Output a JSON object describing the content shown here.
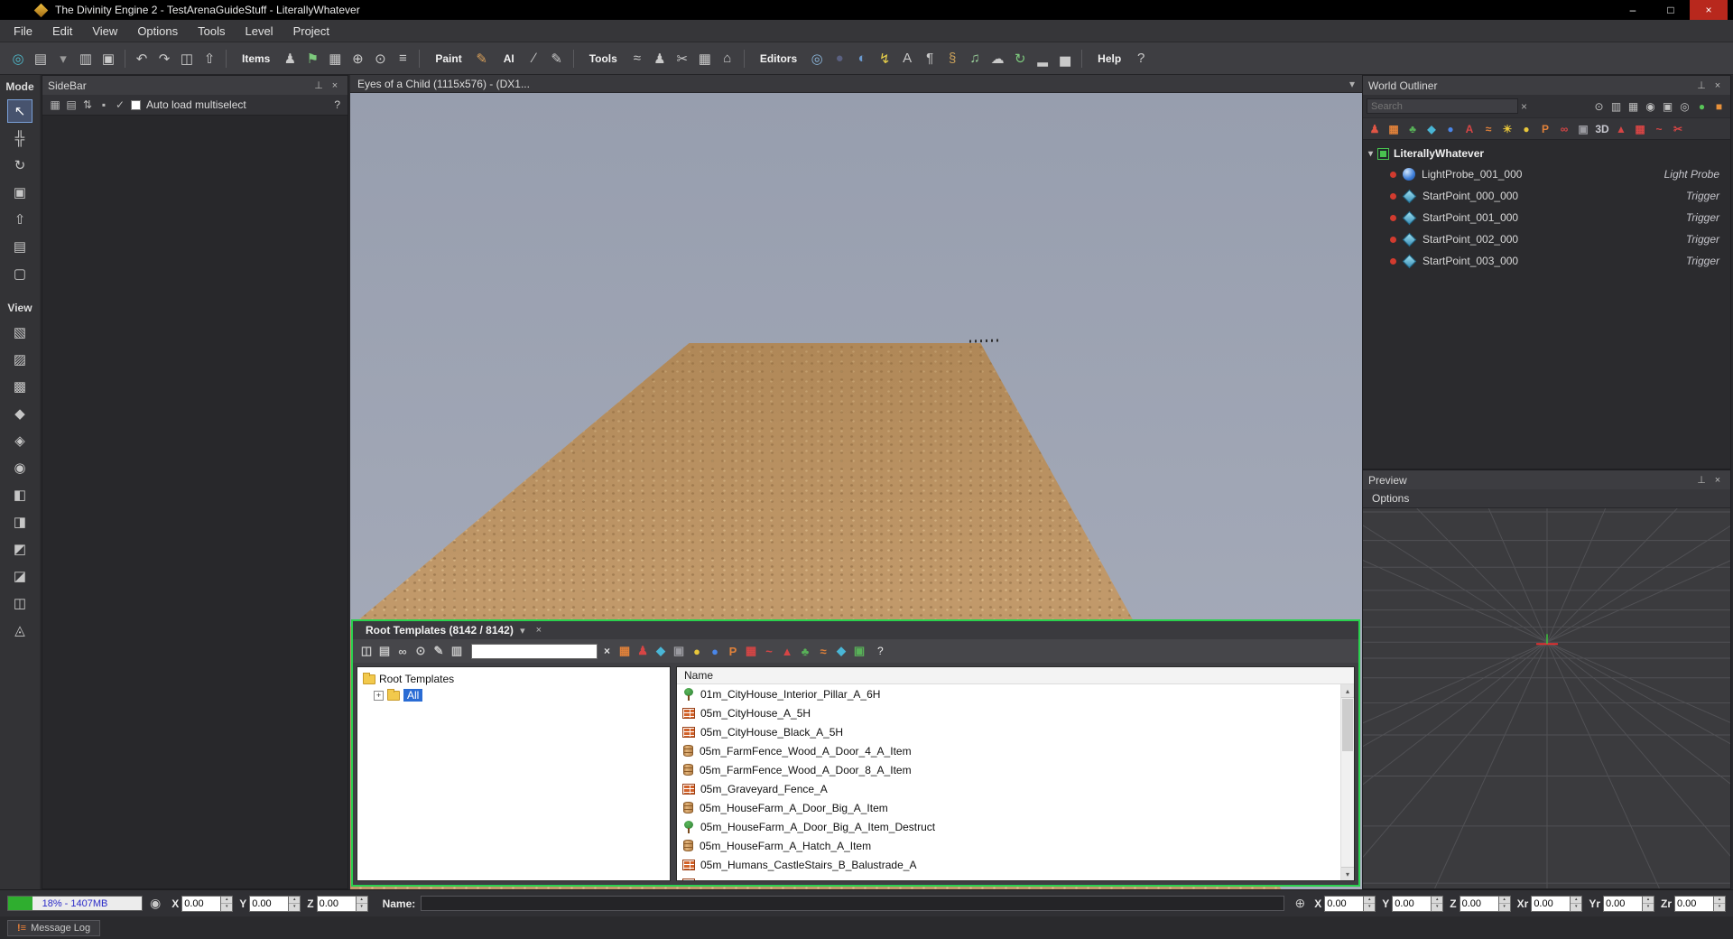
{
  "window": {
    "title": "The Divinity Engine 2 - TestArenaGuideStuff - LiterallyWhatever",
    "minimize_glyph": "–",
    "maximize_glyph": "□",
    "close_glyph": "×"
  },
  "glyphs": {
    "pin": "⊥",
    "close": "×",
    "caret_down": "▾",
    "root_caret": "▾",
    "expander_plus": "+",
    "crosshair": "⊕",
    "camera": "◉",
    "up_arrow": "▴",
    "down_arrow": "▾",
    "clear": "×"
  },
  "menu": {
    "items": [
      "File",
      "Edit",
      "View",
      "Options",
      "Tools",
      "Level",
      "Project"
    ]
  },
  "toolbar": {
    "groups": [
      {
        "type": "icons",
        "icons": [
          {
            "name": "engine-home-icon",
            "glyph": "◎",
            "color": "#4fb8c9"
          },
          {
            "name": "new-document-icon",
            "glyph": "▤",
            "color": "#c9c9c9"
          },
          {
            "name": "new-document-caret-icon",
            "glyph": "▾",
            "color": "#9a9a9a"
          },
          {
            "name": "open-project-icon",
            "glyph": "▥",
            "color": "#c9c9c9"
          },
          {
            "name": "save-all-icon",
            "glyph": "▣",
            "color": "#c9c9c9"
          }
        ]
      },
      {
        "type": "sep"
      },
      {
        "type": "icons",
        "icons": [
          {
            "name": "undo-icon",
            "glyph": "↶",
            "color": "#c9c9c9"
          },
          {
            "name": "redo-icon",
            "glyph": "↷",
            "color": "#c9c9c9"
          },
          {
            "name": "save-icon",
            "glyph": "◫",
            "color": "#c9c9c9"
          },
          {
            "name": "export-icon",
            "glyph": "⇧",
            "color": "#c9c9c9"
          }
        ]
      },
      {
        "type": "sep"
      },
      {
        "type": "label",
        "text": "Items"
      },
      {
        "type": "icons",
        "icons": [
          {
            "name": "character-tool-icon",
            "glyph": "♟",
            "color": "#c9c9c9"
          },
          {
            "name": "flag-tool-icon",
            "glyph": "⚑",
            "color": "#7dc97d"
          },
          {
            "name": "prefab-grid-icon",
            "glyph": "▦",
            "color": "#c9c9c9"
          },
          {
            "name": "snap-target-icon",
            "glyph": "⊕",
            "color": "#c9c9c9"
          },
          {
            "name": "magnify-icon",
            "glyph": "⊙",
            "color": "#c9c9c9"
          },
          {
            "name": "list-icon",
            "glyph": "≡",
            "color": "#c9c9c9"
          }
        ]
      },
      {
        "type": "sep"
      },
      {
        "type": "label",
        "text": "Paint"
      },
      {
        "type": "icons",
        "icons": [
          {
            "name": "paint-brush-icon",
            "glyph": "✎",
            "color": "#d9a05a"
          }
        ]
      },
      {
        "type": "label",
        "text": "AI"
      },
      {
        "type": "icons",
        "icons": [
          {
            "name": "ai-slope-icon",
            "glyph": "∕",
            "color": "#c9c9c9"
          },
          {
            "name": "ai-paint-icon",
            "glyph": "✎",
            "color": "#c9c9c9"
          }
        ]
      },
      {
        "type": "sep"
      },
      {
        "type": "label",
        "text": "Tools"
      },
      {
        "type": "icons",
        "icons": [
          {
            "name": "wave-tool-icon",
            "glyph": "≈",
            "color": "#c9c9c9"
          },
          {
            "name": "crowd-tool-icon",
            "glyph": "♟",
            "color": "#c9c9c9"
          },
          {
            "name": "cut-tool-icon",
            "glyph": "✂",
            "color": "#c9c9c9"
          },
          {
            "name": "grid-tool-icon",
            "glyph": "▦",
            "color": "#c9c9c9"
          },
          {
            "name": "home-tool-icon",
            "glyph": "⌂",
            "color": "#c9c9c9"
          }
        ]
      },
      {
        "type": "sep"
      },
      {
        "type": "label",
        "text": "Editors"
      },
      {
        "type": "icons",
        "icons": [
          {
            "name": "world-editor-icon",
            "glyph": "◎",
            "color": "#8ab4d8"
          },
          {
            "name": "sphere-editor-icon",
            "glyph": "●",
            "color": "#5a6080"
          },
          {
            "name": "planet-editor-icon",
            "glyph": "◐",
            "color": "#6a9ad0"
          },
          {
            "name": "lightning-editor-icon",
            "glyph": "↯",
            "color": "#e8d04a"
          },
          {
            "name": "text-editor-icon",
            "glyph": "A",
            "color": "#c9c9c9"
          },
          {
            "name": "dialog-editor-icon",
            "glyph": "¶",
            "color": "#c9c9c9"
          },
          {
            "name": "script-editor-icon",
            "glyph": "§",
            "color": "#c9a05a"
          },
          {
            "name": "music-editor-icon",
            "glyph": "♫",
            "color": "#9ad09a"
          },
          {
            "name": "cloud-editor-icon",
            "glyph": "☁",
            "color": "#c9c9c9"
          },
          {
            "name": "sync-editor-icon",
            "glyph": "↻",
            "color": "#7dc97d"
          },
          {
            "name": "stats-editor-icon",
            "glyph": "▂",
            "color": "#c9c9c9"
          },
          {
            "name": "chart-editor-icon",
            "glyph": "▅",
            "color": "#c9c9c9"
          }
        ]
      },
      {
        "type": "sep"
      },
      {
        "type": "label",
        "text": "Help"
      },
      {
        "type": "icons",
        "icons": [
          {
            "name": "help-icon",
            "glyph": "?",
            "color": "#c9c9c9"
          }
        ]
      }
    ]
  },
  "mode_panel": {
    "mode_label": "Mode",
    "view_label": "View",
    "mode_tools": [
      {
        "name": "select-tool",
        "glyph": "↖"
      },
      {
        "name": "move-tool",
        "glyph": "╬"
      },
      {
        "name": "rotate-tool",
        "glyph": "↻"
      },
      {
        "name": "terrain-tool",
        "glyph": "▣"
      },
      {
        "name": "raise-tool",
        "glyph": "⇧"
      },
      {
        "name": "texture-tool",
        "glyph": "▤"
      },
      {
        "name": "document-tool",
        "glyph": "▢"
      }
    ],
    "view_tools": [
      {
        "name": "view-cube-icon",
        "glyph": "▧"
      },
      {
        "name": "view-shaded-icon",
        "glyph": "▨"
      },
      {
        "name": "view-wireframe-icon",
        "glyph": "▩"
      },
      {
        "name": "view-normals-icon",
        "glyph": "◆"
      },
      {
        "name": "view-gizmo-icon",
        "glyph": "◈"
      },
      {
        "name": "view-camera-icon",
        "glyph": "◉"
      },
      {
        "name": "view-left-icon",
        "glyph": "◧"
      },
      {
        "name": "view-right-icon",
        "glyph": "◨"
      },
      {
        "name": "view-top-icon",
        "glyph": "◩"
      },
      {
        "name": "view-bottom-icon",
        "glyph": "◪"
      },
      {
        "name": "view-split-icon",
        "glyph": "◫"
      },
      {
        "name": "view-iso-icon",
        "glyph": "◬"
      }
    ]
  },
  "sidebar": {
    "title": "SideBar",
    "icons": [
      {
        "name": "sidebar-grid-icon",
        "glyph": "▦"
      },
      {
        "name": "sidebar-list-icon",
        "glyph": "▤"
      },
      {
        "name": "sidebar-sort-icon",
        "glyph": "⇅"
      },
      {
        "name": "sidebar-lock-icon",
        "glyph": "▪"
      },
      {
        "name": "sidebar-apply-icon",
        "glyph": "✓"
      }
    ],
    "auto_load_label": "Auto load multiselect",
    "help_label": "?"
  },
  "viewport": {
    "tab_title": "Eyes of a Child (1115x576) - (DX1..."
  },
  "world_outliner": {
    "title": "World Outliner",
    "search_placeholder": "Search",
    "header_icons": [
      {
        "name": "outliner-search-icon",
        "glyph": "⊙",
        "color": "#c0c0c0"
      },
      {
        "name": "outliner-copy-icon",
        "glyph": "▥",
        "color": "#c0c0c0"
      },
      {
        "name": "outliner-group-icon",
        "glyph": "▦",
        "color": "#c0c0c0"
      },
      {
        "name": "outliner-eye-icon",
        "glyph": "◉",
        "color": "#c0c0c0"
      },
      {
        "name": "outliner-lock-icon",
        "glyph": "▣",
        "color": "#c0c0c0"
      },
      {
        "name": "outliner-world-icon",
        "glyph": "◎",
        "color": "#c0c0c0"
      },
      {
        "name": "outliner-status-green-icon",
        "glyph": "●",
        "color": "#58c558"
      },
      {
        "name": "outliner-status-orange-icon",
        "glyph": "■",
        "color": "#e8913a"
      }
    ],
    "filters": [
      {
        "name": "filter-character-icon",
        "glyph": "♟",
        "color": "#e05545"
      },
      {
        "name": "filter-scenery-icon",
        "glyph": "▦",
        "color": "#e0813a"
      },
      {
        "name": "filter-vegetation-icon",
        "glyph": "♣",
        "color": "#58b158"
      },
      {
        "name": "filter-trigger-icon",
        "glyph": "◆",
        "color": "#49b6d6"
      },
      {
        "name": "filter-light-icon",
        "glyph": "●",
        "color": "#4a86e8"
      },
      {
        "name": "filter-decal-icon",
        "glyph": "A",
        "color": "#d64545"
      },
      {
        "name": "filter-effect-icon",
        "glyph": "≈",
        "color": "#e0813a"
      },
      {
        "name": "filter-lightprobe-icon",
        "glyph": "☀",
        "color": "#e8c63a"
      },
      {
        "name": "filter-bulb-icon",
        "glyph": "●",
        "color": "#e8c63a"
      },
      {
        "name": "filter-prefab-icon",
        "glyph": "P",
        "color": "#e0813a"
      },
      {
        "name": "filter-link-icon",
        "glyph": "∞",
        "color": "#d64545"
      },
      {
        "name": "filter-camera-icon",
        "glyph": "▣",
        "color": "#9a9aa0"
      },
      {
        "name": "filter-3d-icon",
        "glyph": "3D",
        "color": "#c8c8d0"
      },
      {
        "name": "filter-terrain-icon",
        "glyph": "▲",
        "color": "#d64545"
      },
      {
        "name": "filter-region-icon",
        "glyph": "▦",
        "color": "#d64545"
      },
      {
        "name": "filter-spline-icon",
        "glyph": "~",
        "color": "#d64545"
      },
      {
        "name": "filter-misc-icon",
        "glyph": "✂",
        "color": "#d64545"
      }
    ],
    "root_label": "LiterallyWhatever",
    "items": [
      {
        "icon": "light-probe",
        "name": "LightProbe_001_000",
        "type": "Light Probe"
      },
      {
        "icon": "trigger",
        "name": "StartPoint_000_000",
        "type": "Trigger"
      },
      {
        "icon": "trigger",
        "name": "StartPoint_001_000",
        "type": "Trigger"
      },
      {
        "icon": "trigger",
        "name": "StartPoint_002_000",
        "type": "Trigger"
      },
      {
        "icon": "trigger",
        "name": "StartPoint_003_000",
        "type": "Trigger"
      }
    ]
  },
  "preview": {
    "title": "Preview",
    "options_label": "Options"
  },
  "root_templates": {
    "title": "Root Templates (8142 / 8142)",
    "toolbar_icons": [
      {
        "name": "rt-save-icon",
        "glyph": "◫"
      },
      {
        "name": "rt-import-icon",
        "glyph": "▤"
      },
      {
        "name": "rt-link-icon",
        "glyph": "∞"
      },
      {
        "name": "rt-binocular-icon",
        "glyph": "⊙"
      },
      {
        "name": "rt-edit-icon",
        "glyph": "✎"
      },
      {
        "name": "rt-list-icon",
        "glyph": "▥"
      }
    ],
    "filter_icons": [
      {
        "name": "rt-filter-scenery-icon",
        "glyph": "▦",
        "color": "#e0813a"
      },
      {
        "name": "rt-filter-character-icon",
        "glyph": "♟",
        "color": "#d64545"
      },
      {
        "name": "rt-filter-trigger-icon",
        "glyph": "◆",
        "color": "#49b6d6"
      },
      {
        "name": "rt-filter-item-icon",
        "glyph": "▣",
        "color": "#9a9aa0"
      },
      {
        "name": "rt-filter-light-icon",
        "glyph": "●",
        "color": "#e8c63a"
      },
      {
        "name": "rt-filter-sphere-icon",
        "glyph": "●",
        "color": "#4a86e8"
      },
      {
        "name": "rt-filter-prefab-icon",
        "glyph": "P",
        "color": "#e0813a"
      },
      {
        "name": "rt-filter-grid-icon",
        "glyph": "▦",
        "color": "#d64545"
      },
      {
        "name": "rt-filter-spline-icon",
        "glyph": "~",
        "color": "#d64545"
      },
      {
        "name": "rt-filter-terrain-icon",
        "glyph": "▲",
        "color": "#d64545"
      },
      {
        "name": "rt-filter-vegetation-icon",
        "glyph": "♣",
        "color": "#58b158"
      },
      {
        "name": "rt-filter-effect-icon",
        "glyph": "≈",
        "color": "#e0813a"
      },
      {
        "name": "rt-filter-decal-icon",
        "glyph": "◆",
        "color": "#49b6d6"
      },
      {
        "name": "rt-filter-box-icon",
        "glyph": "▣",
        "color": "#58b158"
      }
    ],
    "help_label": "?",
    "tree": {
      "root": "Root Templates",
      "child": "All"
    },
    "list": {
      "header": "Name",
      "rows": [
        {
          "icon": "tree",
          "name": "01m_CityHouse_Interior_Pillar_A_6H"
        },
        {
          "icon": "brick",
          "name": "05m_CityHouse_A_5H"
        },
        {
          "icon": "brick",
          "name": "05m_CityHouse_Black_A_5H"
        },
        {
          "icon": "barrel",
          "name": "05m_FarmFence_Wood_A_Door_4_A_Item"
        },
        {
          "icon": "barrel",
          "name": "05m_FarmFence_Wood_A_Door_8_A_Item"
        },
        {
          "icon": "brick",
          "name": "05m_Graveyard_Fence_A"
        },
        {
          "icon": "barrel",
          "name": "05m_HouseFarm_A_Door_Big_A_Item"
        },
        {
          "icon": "tree",
          "name": "05m_HouseFarm_A_Door_Big_A_Item_Destruct"
        },
        {
          "icon": "barrel",
          "name": "05m_HouseFarm_A_Hatch_A_Item"
        },
        {
          "icon": "brick",
          "name": "05m_Humans_CastleStairs_B_Balustrade_A"
        }
      ],
      "partial_row": {
        "icon": "brick"
      }
    }
  },
  "status_bar": {
    "progress_text": "18% - 1407MB",
    "progress_pct": 18,
    "left_coords": [
      {
        "label": "X",
        "value": "0.00"
      },
      {
        "label": "Y",
        "value": "0.00"
      },
      {
        "label": "Z",
        "value": "0.00"
      }
    ],
    "name_label": "Name:",
    "name_value": "",
    "right_coords": [
      {
        "label": "X",
        "value": "0.00"
      },
      {
        "label": "Y",
        "value": "0.00"
      },
      {
        "label": "Z",
        "value": "0.00"
      },
      {
        "label": "Xr",
        "value": "0.00"
      },
      {
        "label": "Yr",
        "value": "0.00"
      },
      {
        "label": "Zr",
        "value": "0.00"
      }
    ]
  },
  "message_log": {
    "label": "Message Log"
  },
  "colors": {
    "selection_border": "#29d14e",
    "selected_item_bg": "#2a6cd4",
    "progress_green": "#2fae2f",
    "progress_text_blue": "#2929c8",
    "record_red": "#d23b2f"
  }
}
